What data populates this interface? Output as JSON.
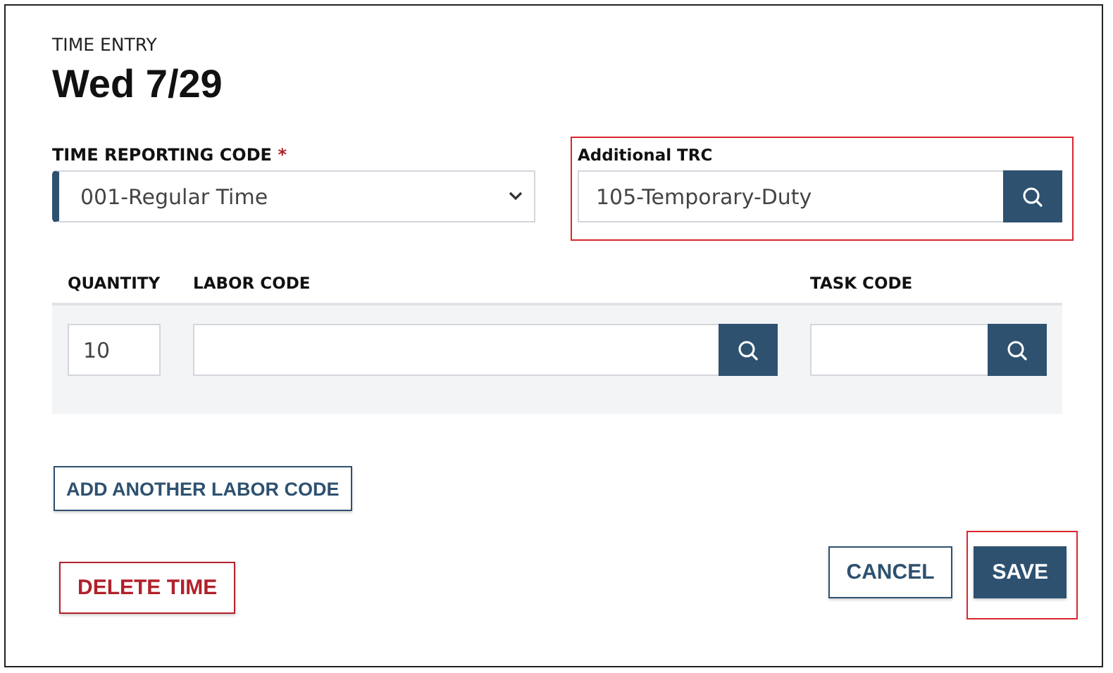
{
  "header": {
    "eyebrow": "TIME ENTRY",
    "title": "Wed 7/29"
  },
  "time_reporting_code": {
    "label": "TIME REPORTING CODE",
    "required_mark": "*",
    "value": "001-Regular Time"
  },
  "additional_trc": {
    "label": "Additional TRC",
    "value": "105-Temporary-Duty",
    "highlighted": true
  },
  "labor_table": {
    "columns": [
      "QUANTITY",
      "LABOR CODE",
      "TASK CODE"
    ],
    "rows": [
      {
        "quantity": "10"
      }
    ]
  },
  "add_labor_button": {
    "label": "ADD ANOTHER LABOR CODE",
    "kind": "outline",
    "highlighted": false
  },
  "footer": {
    "left": [
      {
        "label": "DELETE TIME",
        "kind": "danger",
        "highlighted": false
      }
    ],
    "right": [
      {
        "label": "CANCEL",
        "kind": "outline",
        "highlighted": false
      },
      {
        "label": "SAVE",
        "kind": "primary",
        "highlighted": true
      }
    ]
  }
}
